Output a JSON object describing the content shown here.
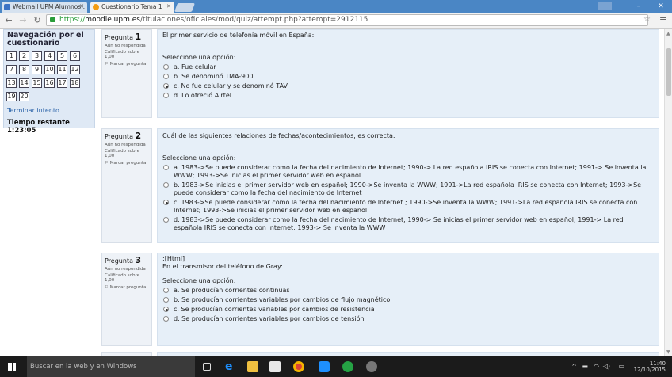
{
  "browser": {
    "tabs": [
      {
        "title": "Webmail UPM Alumnos ::",
        "active": false
      },
      {
        "title": "Cuestionario Tema 1",
        "active": true
      }
    ],
    "url_scheme": "https://",
    "url_host": "moodle.upm.es",
    "url_path": "/titulaciones/oficiales/mod/quiz/attempt.php?attempt=2912115"
  },
  "nav": {
    "title": "Navegación por el cuestionario",
    "question_numbers": [
      "1",
      "2",
      "3",
      "4",
      "5",
      "6",
      "7",
      "8",
      "9",
      "10",
      "11",
      "12",
      "13",
      "14",
      "15",
      "16",
      "17",
      "18",
      "19",
      "20"
    ],
    "finish_link": "Terminar intento...",
    "time_remaining": "Tiempo restante 1:23:05"
  },
  "questions": [
    {
      "label": "Pregunta",
      "number": "1",
      "status": "Aún no respondida",
      "score": "Calificado sobre 1,00",
      "flag": "Marcar pregunta",
      "pre": "",
      "text": "El primer servicio de telefonía móvil en España:",
      "prompt": "Seleccione una opción:",
      "options": [
        {
          "text": "a. Fue celular",
          "selected": false
        },
        {
          "text": "b. Se denominó TMA-900",
          "selected": false
        },
        {
          "text": "c. No fue celular y se denominó TAV",
          "selected": true
        },
        {
          "text": "d. Lo ofreció Airtel",
          "selected": false
        }
      ]
    },
    {
      "label": "Pregunta",
      "number": "2",
      "status": "Aún no respondida",
      "score": "Calificado sobre 1,00",
      "flag": "Marcar pregunta",
      "pre": "",
      "text": "Cuál de las siguientes relaciones de fechas/acontecimientos, es correcta:",
      "prompt": "Seleccione una opción:",
      "options": [
        {
          "text": "a. 1983->Se puede considerar como la fecha del nacimiento de Internet; 1990-> La red española IRIS se conecta con Internet; 1991-> Se inventa la WWW; 1993->Se inicias el primer servidor web en español",
          "selected": false
        },
        {
          "text": "b. 1983->Se inicias el primer servidor web en español; 1990->Se inventa la WWW; 1991->La red española IRIS se conecta con Internet; 1993->Se puede considerar como la fecha del nacimiento de Internet",
          "selected": false
        },
        {
          "text": "c. 1983->Se puede considerar como la fecha del nacimiento de Internet ; 1990->Se inventa la WWW; 1991->La red española IRIS se conecta con Internet; 1993->Se inicias el primer servidor web en español",
          "selected": true
        },
        {
          "text": "d. 1983->Se puede considerar como la fecha del nacimiento de Internet; 1990-> Se inicias el primer servidor web en español; 1991-> La red española IRIS se conecta con Internet; 1993-> Se inventa la WWW",
          "selected": false
        }
      ]
    },
    {
      "label": "Pregunta",
      "number": "3",
      "status": "Aún no respondida",
      "score": "Calificado sobre 1,00",
      "flag": "Marcar pregunta",
      "pre": ":[Html]",
      "text": "En el transmisor del teléfono de Gray:",
      "prompt": "Seleccione una opción:",
      "options": [
        {
          "text": "a. Se producían corrientes continuas",
          "selected": false
        },
        {
          "text": "b. Se producían corrientes variables por cambios de flujo magnético",
          "selected": false
        },
        {
          "text": "c. Se producían corrientes variables por cambios de resistencia",
          "selected": true
        },
        {
          "text": "d. Se producían corrientes variables por cambios de tensión",
          "selected": false
        }
      ]
    }
  ],
  "taskbar": {
    "search_placeholder": "Buscar en la web y en Windows",
    "time": "11:40",
    "date": "12/10/2015"
  },
  "colors": {
    "tab_strip": "#4a86c5",
    "question_bg": "#e6eff8",
    "nav_bg": "#dfe9f5",
    "link": "#2a62a8",
    "taskbar": "#1b1b1b"
  }
}
